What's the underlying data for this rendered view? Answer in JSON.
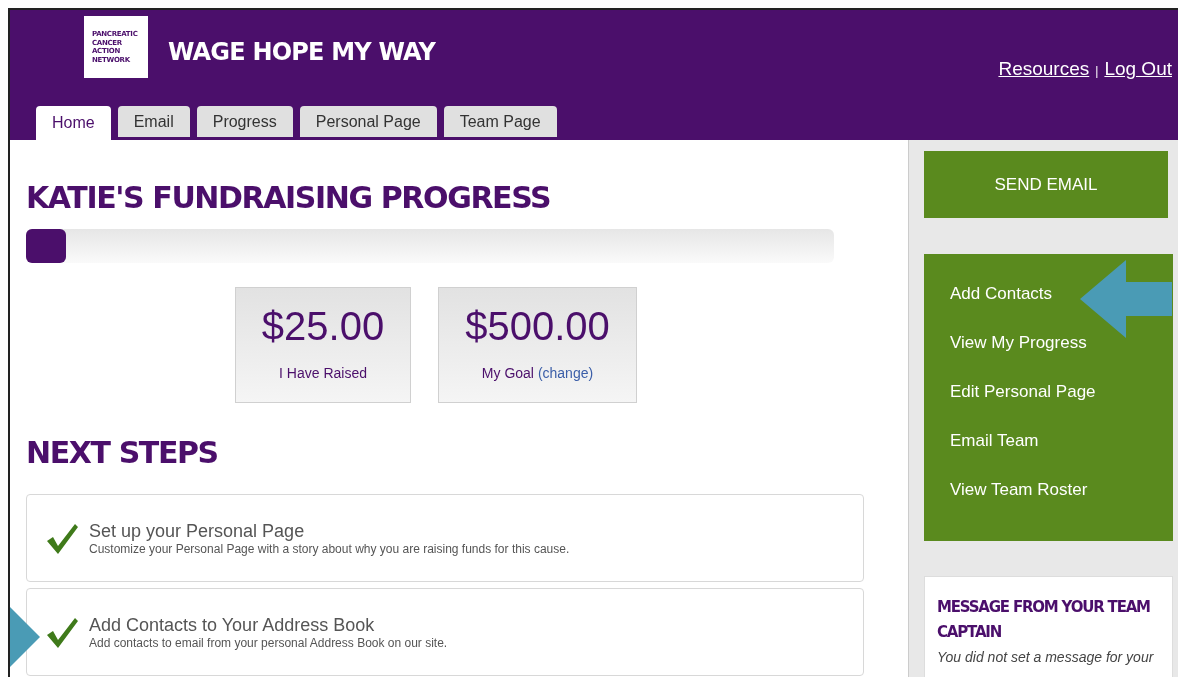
{
  "header": {
    "logo": [
      "PANCREATIC",
      "CANCER",
      "ACTION",
      "NETWORK"
    ],
    "title": "WAGE HOPE MY WAY",
    "links": [
      "Resources",
      "Log Out"
    ],
    "separator": "|"
  },
  "tabs": [
    {
      "label": "Home",
      "selected": true
    },
    {
      "label": "Email",
      "selected": false
    },
    {
      "label": "Progress",
      "selected": false
    },
    {
      "label": "Personal Page",
      "selected": false
    },
    {
      "label": "Team Page",
      "selected": false
    }
  ],
  "progress": {
    "title": "KATIE'S FUNDRAISING PROGRESS",
    "level": 0.05,
    "stats": [
      {
        "amount": "$25.00",
        "label": "I Have Raised"
      },
      {
        "amount": "$500.00",
        "label": "My Goal",
        "link": "(change)"
      }
    ]
  },
  "next_steps": {
    "title": "NEXT STEPS",
    "items": [
      {
        "title": "Set up your Personal Page",
        "text": "Customize your Personal Page with a story about why you are raising funds for this cause.",
        "completed": true
      },
      {
        "title": "Add Contacts to Your Address Book",
        "text": "Add contacts to email from your personal Address Book on our site.",
        "completed": true
      }
    ]
  },
  "sidebar": {
    "button": "SEND EMAIL",
    "links": [
      "Add Contacts",
      "View My Progress",
      "Edit Personal Page",
      "Email Team",
      "View Team Roster"
    ],
    "message": {
      "title": "MESSAGE FROM YOUR TEAM CAPTAIN",
      "text": "You did not set a message for your"
    }
  }
}
